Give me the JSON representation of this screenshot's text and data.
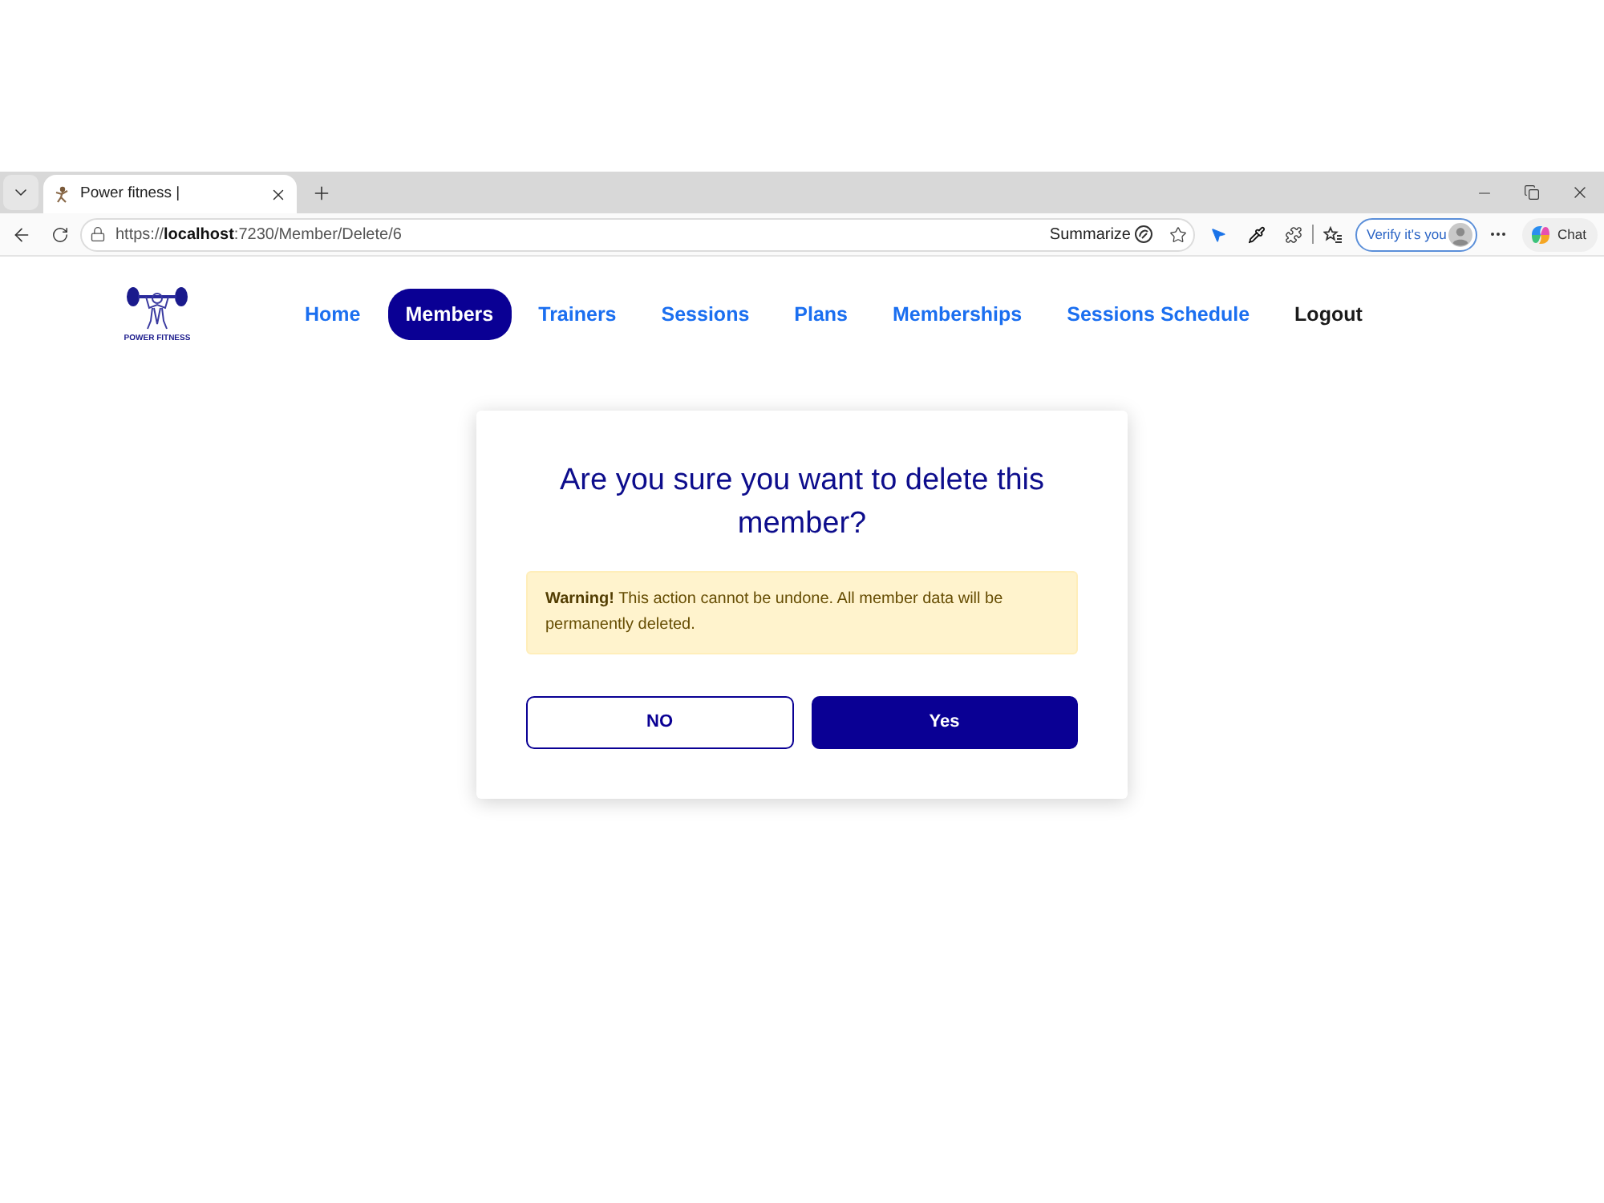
{
  "browser": {
    "tabs": [
      {
        "title": "Power fitness |",
        "selected": true
      }
    ],
    "url": "https://**localhost**:7230/Member/Delete/6",
    "summarize": "Summarize",
    "verify": "Verify it's you",
    "chat": "Chat"
  },
  "nav": {
    "logo_text": "POWER FITNESS",
    "items": [
      {
        "label": "Home",
        "kind": "link",
        "selected": false
      },
      {
        "label": "Members",
        "kind": "link",
        "selected": true
      },
      {
        "label": "Trainers",
        "kind": "link",
        "selected": false
      },
      {
        "label": "Sessions",
        "kind": "link",
        "selected": false
      },
      {
        "label": "Plans",
        "kind": "link",
        "selected": false
      },
      {
        "label": "Memberships",
        "kind": "link",
        "selected": false
      },
      {
        "label": "Sessions Schedule",
        "kind": "link",
        "selected": false
      },
      {
        "label": "Logout",
        "kind": "action",
        "selected": false
      }
    ]
  },
  "dialog": {
    "title": "Are you sure you want to delete this member?",
    "warning": "**Warning!** This action cannot be undone. All member data will be permanently deleted.",
    "buttons": [
      {
        "label": "NO",
        "kind": "outline"
      },
      {
        "label": "Yes",
        "kind": "primary"
      }
    ]
  }
}
